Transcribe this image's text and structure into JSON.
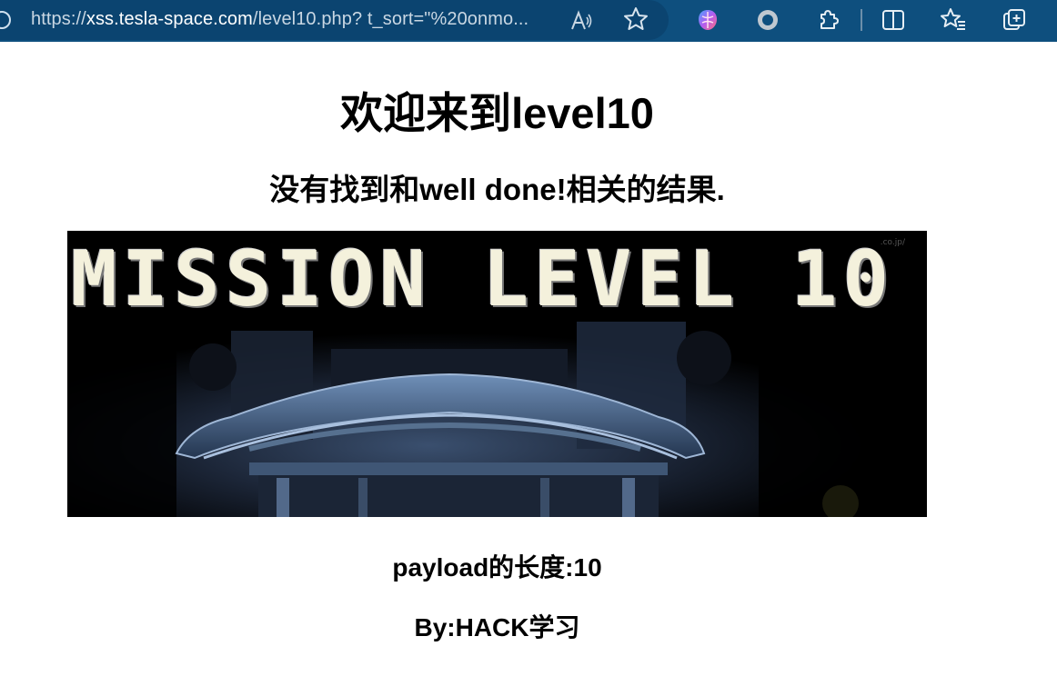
{
  "browser": {
    "url_prefix": "https://",
    "url_host": "xss.tesla-space.com",
    "url_rest": "/level10.php?  t_sort=\"%20onmo...",
    "icons": [
      "site-info-icon",
      "read-aloud-icon",
      "favorite-star-icon",
      "copilot-icon",
      "record-icon",
      "extensions-icon",
      "split-screen-icon",
      "favorites-icon",
      "collections-icon"
    ],
    "read_aloud_glyph": "A͆",
    "colors": {
      "toolbar": "#0e4f7e",
      "addressbar": "#0b4470",
      "url_text": "#c9d7e3"
    }
  },
  "page": {
    "title": "欢迎来到level10",
    "result_message": "没有找到和well done!相关的结果.",
    "banner": {
      "title_text": "MISSION LEVEL 10",
      "watermark": ".co.jp/"
    },
    "payload_length": "payload的长度:10",
    "byline": "By:HACK学习"
  }
}
